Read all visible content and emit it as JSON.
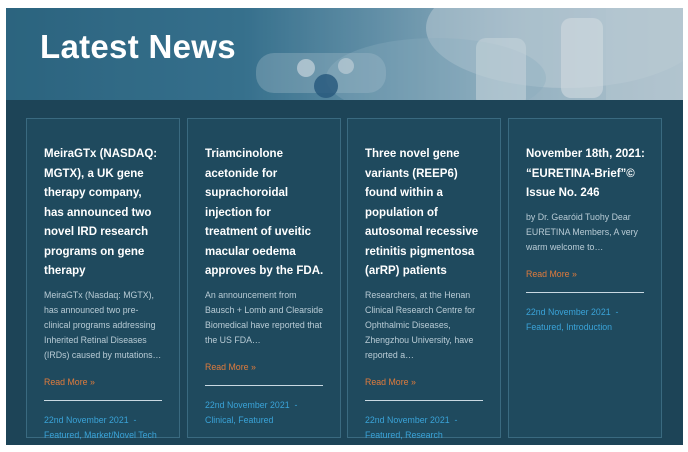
{
  "hero": {
    "title": "Latest News"
  },
  "colors": {
    "background": "#1d4457",
    "card": "#1f4a5e",
    "title": "#ffffff",
    "excerpt": "#b9ccd6",
    "read_more": "#e07b3c",
    "meta": "#3aa3d8"
  },
  "cards": [
    {
      "title": "MeiraGTx (NASDAQ: MGTX), a UK gene therapy company, has announced two novel IRD research programs on gene therapy",
      "excerpt": "MeiraGTx (Nasdaq: MGTX), has announced two pre-clinical programs addressing Inherited Retinal Diseases (IRDs) caused by mutations…",
      "read_more": "Read More »",
      "date": "22nd November 2021",
      "separator": "-",
      "tags": "Featured, Market/Novel Tech"
    },
    {
      "title": "Triamcinolone acetonide for suprachoroidal injection for treatment of uveitic macular oedema approves by the FDA.",
      "excerpt": "An announcement from Bausch + Lomb and Clearside Biomedical have reported that the US FDA…",
      "read_more": "Read More »",
      "date": "22nd November 2021",
      "separator": "-",
      "tags": "Clinical, Featured"
    },
    {
      "title": "Three novel gene variants (REEP6) found within a population of autosomal recessive retinitis pigmentosa (arRP) patients",
      "excerpt": "Researchers, at the Henan Clinical Research Centre for Ophthalmic Diseases, Zhengzhou University, have reported a…",
      "read_more": "Read More »",
      "date": "22nd November 2021",
      "separator": "-",
      "tags": "Featured, Research"
    },
    {
      "title": "November 18th, 2021: “EURETINA-Brief”© Issue No. 246",
      "excerpt": "by Dr. Gearóid Tuohy    Dear EURETINA Members,  A very warm welcome to…",
      "read_more": "Read More »",
      "date": "22nd November 2021",
      "separator": "-",
      "tags": "Featured, Introduction"
    }
  ]
}
